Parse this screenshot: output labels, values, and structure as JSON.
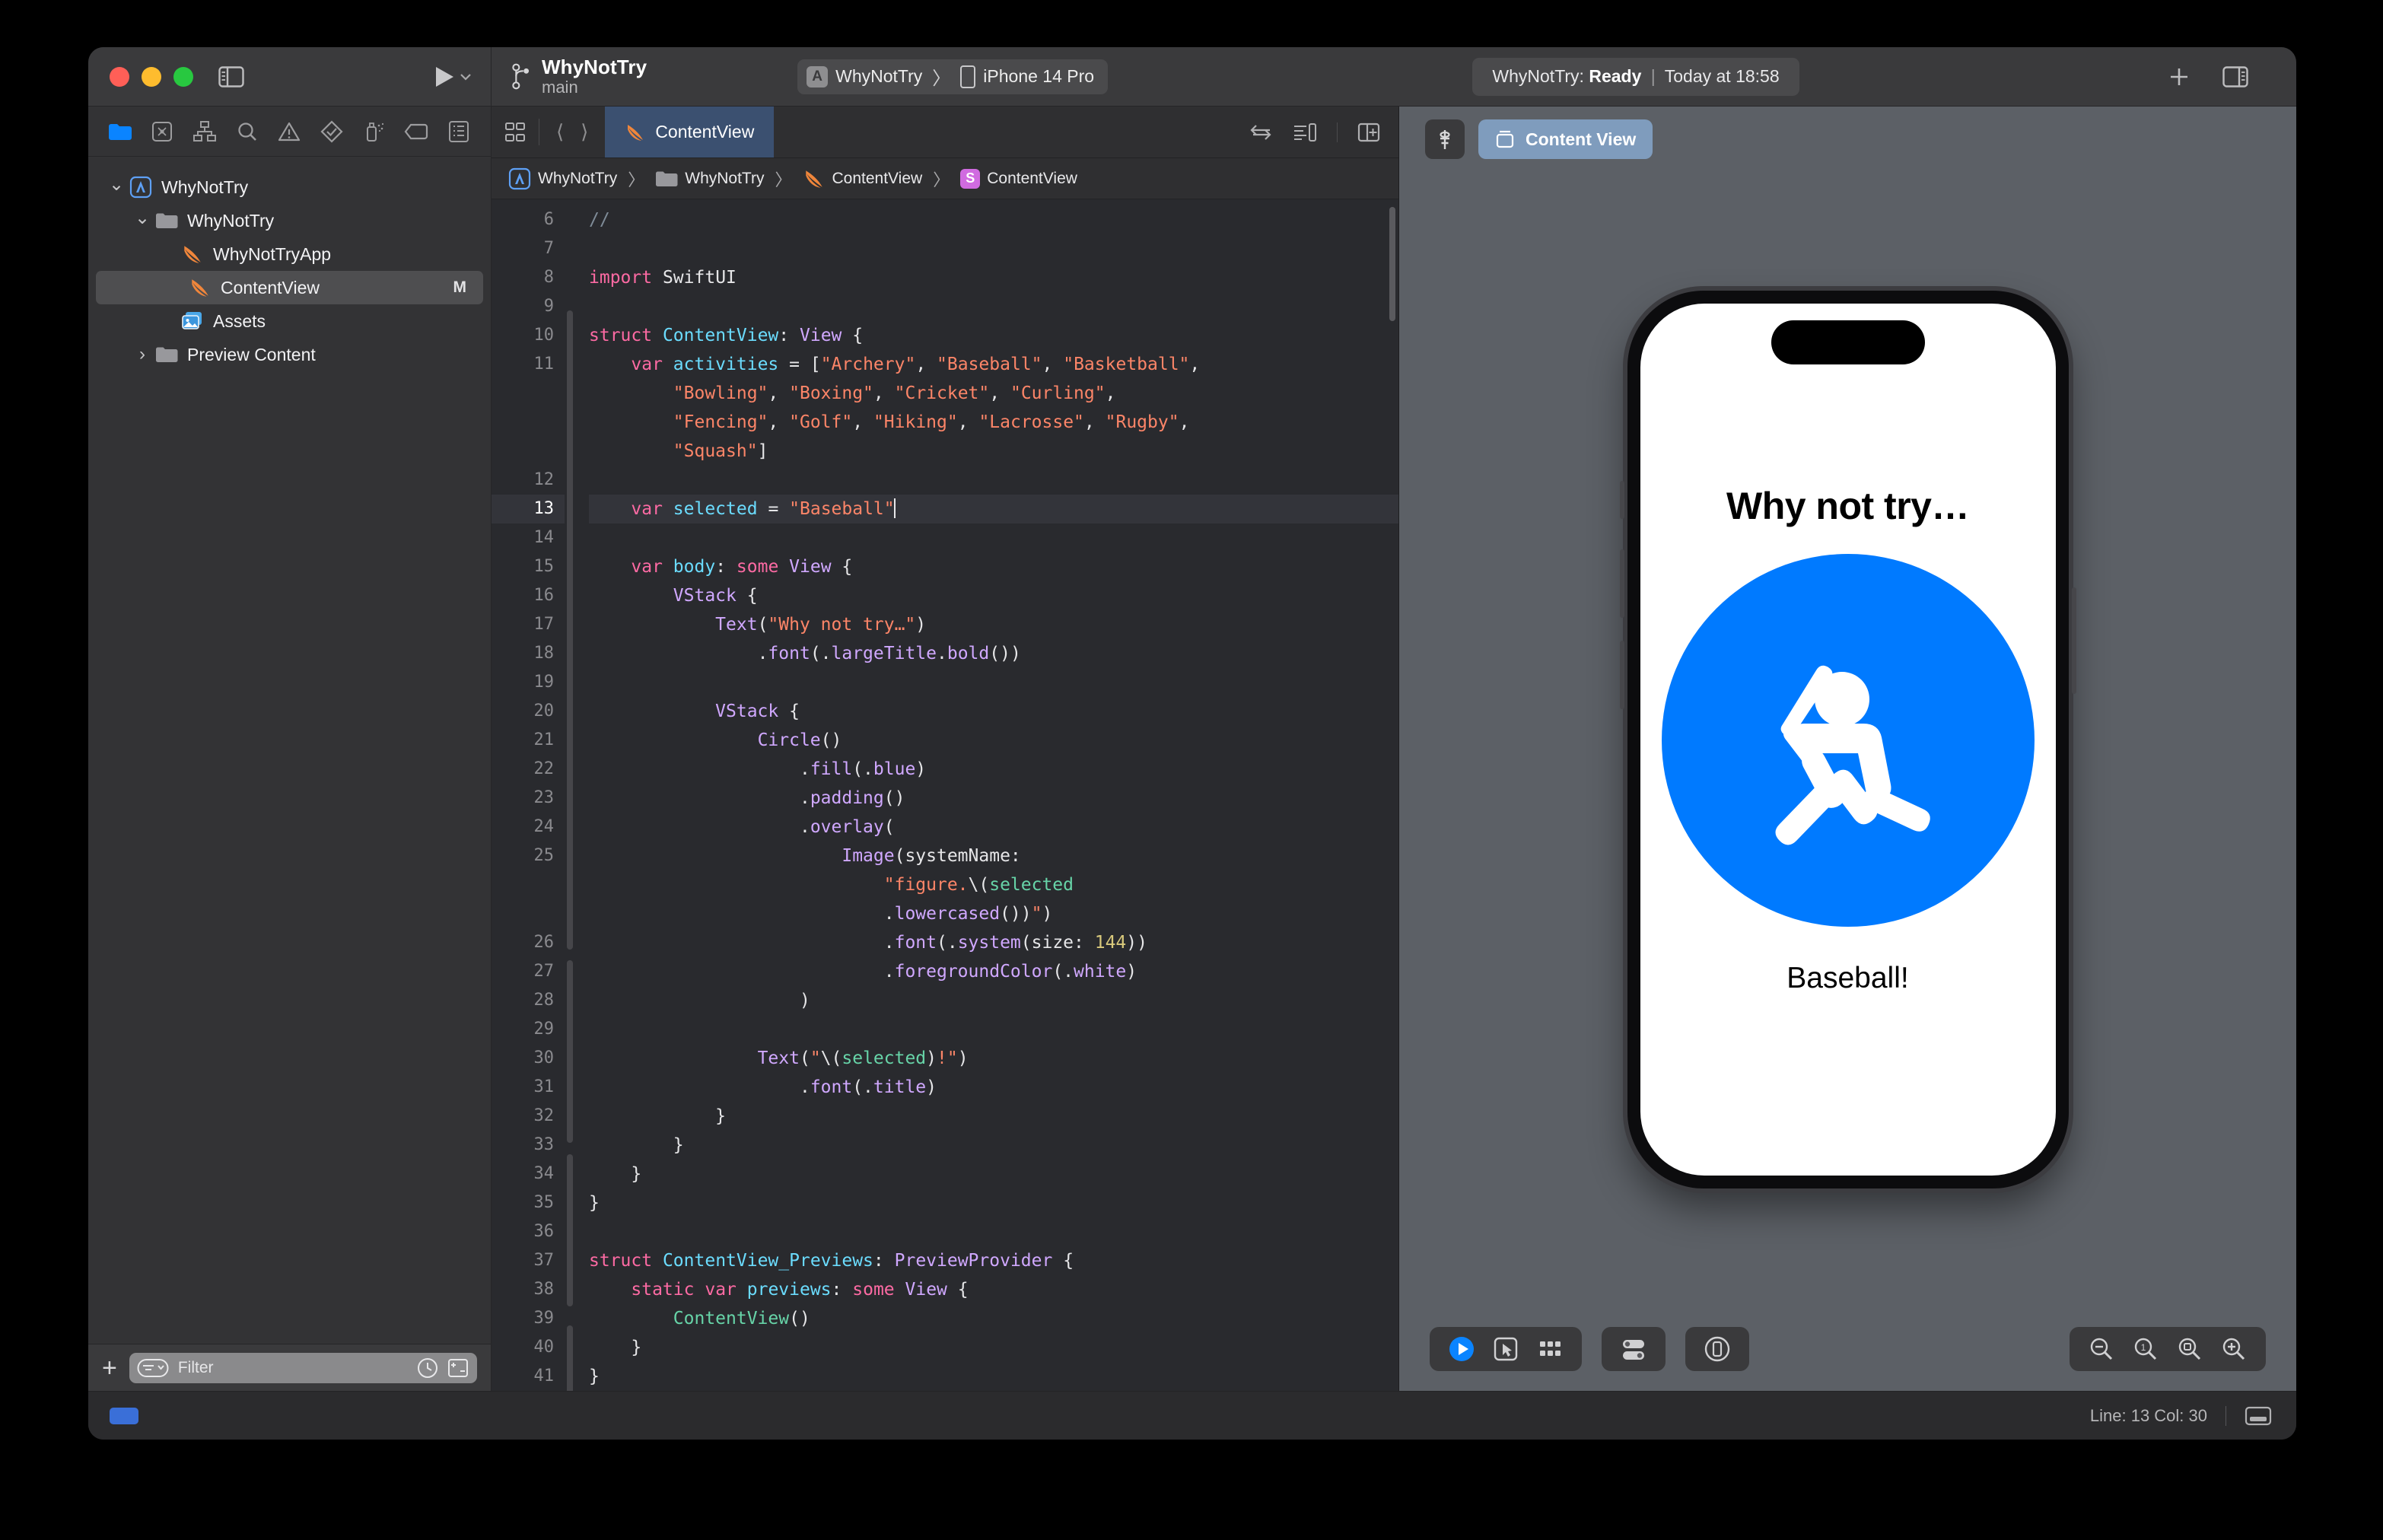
{
  "window": {
    "traffic_lights": [
      "close",
      "minimize",
      "zoom"
    ],
    "sidebar_toggle_icon": "sidebar-icon",
    "run_icon": "play-icon",
    "add_icon": "plus-icon",
    "inspector_toggle_icon": "inspector-icon"
  },
  "toolbar": {
    "project_title": "WhyNotTry",
    "branch": "main",
    "branch_icon": "branch-icon",
    "scheme": {
      "app_icon": "app-store-icon",
      "scheme_name": "WhyNotTry",
      "chevron": "〉",
      "device_icon": "iphone-icon",
      "destination": "iPhone 14 Pro"
    },
    "status": {
      "prefix": "WhyNotTry:",
      "state": "Ready",
      "separator": "|",
      "time": "Today at 18:58"
    }
  },
  "navigator": {
    "tabs": [
      {
        "name": "project-navigator",
        "icon": "folder-icon",
        "active": true
      },
      {
        "name": "source-control-navigator",
        "icon": "source-control-icon",
        "active": false
      },
      {
        "name": "symbol-navigator",
        "icon": "hierarchy-icon",
        "active": false
      },
      {
        "name": "find-navigator",
        "icon": "search-icon",
        "active": false
      },
      {
        "name": "issue-navigator",
        "icon": "warning-icon",
        "active": false
      },
      {
        "name": "test-navigator",
        "icon": "test-diamond-icon",
        "active": false
      },
      {
        "name": "debug-navigator",
        "icon": "spray-icon",
        "active": false
      },
      {
        "name": "breakpoint-navigator",
        "icon": "tag-icon",
        "active": false
      },
      {
        "name": "report-navigator",
        "icon": "report-icon",
        "active": false
      }
    ],
    "tree": [
      {
        "label": "WhyNotTry",
        "icon": "app-project-icon",
        "depth": 0,
        "twisty": "down",
        "selected": false,
        "badge": ""
      },
      {
        "label": "WhyNotTry",
        "icon": "folder-icon",
        "depth": 1,
        "twisty": "down",
        "selected": false,
        "badge": ""
      },
      {
        "label": "WhyNotTryApp",
        "icon": "swift-icon",
        "depth": 2,
        "twisty": "none",
        "selected": false,
        "badge": ""
      },
      {
        "label": "ContentView",
        "icon": "swift-icon",
        "depth": 2,
        "twisty": "none",
        "selected": true,
        "badge": "M"
      },
      {
        "label": "Assets",
        "icon": "assets-icon",
        "depth": 2,
        "twisty": "none",
        "selected": false,
        "badge": ""
      },
      {
        "label": "Preview Content",
        "icon": "folder-icon",
        "depth": 1,
        "twisty": "right",
        "selected": false,
        "badge": ""
      }
    ],
    "filter": {
      "add_icon": "plus-icon",
      "filter_menu_icon": "filter-menu-icon",
      "placeholder": "Filter",
      "recent_icon": "clock-icon",
      "source-control_icon": "added-removed-icon"
    }
  },
  "editor": {
    "tab_grid_icon": "tab-grid-icon",
    "back_icon": "chevron-left-icon",
    "forward_icon": "chevron-right-icon",
    "open_tab": {
      "label": "ContentView",
      "icon": "swift-icon"
    },
    "right_icons": [
      "related-items-icon",
      "minimap-icon",
      "add-editor-icon"
    ],
    "jumpbar": [
      {
        "label": "WhyNotTry",
        "icon": "app-project-icon"
      },
      {
        "label": "WhyNotTry",
        "icon": "folder-icon"
      },
      {
        "label": "ContentView",
        "icon": "swift-icon"
      },
      {
        "label": "ContentView",
        "icon": "struct-symbol-icon"
      }
    ],
    "cursor_line": 13,
    "lines": [
      {
        "n": "6",
        "html": "<span class='cmt'>//</span>"
      },
      {
        "n": "7",
        "html": ""
      },
      {
        "n": "8",
        "html": "<span class='kw'>import</span> <span class='plain'>SwiftUI</span>"
      },
      {
        "n": "9",
        "html": ""
      },
      {
        "n": "10",
        "html": "<span class='kw'>struct</span> <span class='typ'>ContentView</span><span class='plain'>:</span> <span class='typ2'>View</span> <span class='plain'>{</span>"
      },
      {
        "n": "11",
        "html": "    <span class='kw'>var</span> <span class='var'>activities</span> <span class='plain'>= [</span><span class='str'>\"Archery\"</span><span class='plain'>,</span> <span class='str'>\"Baseball\"</span><span class='plain'>,</span> <span class='str'>\"Basketball\"</span><span class='plain'>,</span>"
      },
      {
        "n": "",
        "html": "        <span class='str'>\"Bowling\"</span><span class='plain'>,</span> <span class='str'>\"Boxing\"</span><span class='plain'>,</span> <span class='str'>\"Cricket\"</span><span class='plain'>,</span> <span class='str'>\"Curling\"</span><span class='plain'>,</span>"
      },
      {
        "n": "",
        "html": "        <span class='str'>\"Fencing\"</span><span class='plain'>,</span> <span class='str'>\"Golf\"</span><span class='plain'>,</span> <span class='str'>\"Hiking\"</span><span class='plain'>,</span> <span class='str'>\"Lacrosse\"</span><span class='plain'>,</span> <span class='str'>\"Rugby\"</span><span class='plain'>,</span>"
      },
      {
        "n": "",
        "html": "        <span class='str'>\"Squash\"</span><span class='plain'>]</span>"
      },
      {
        "n": "12",
        "html": ""
      },
      {
        "n": "13",
        "html": "    <span class='kw'>var</span> <span class='var'>selected</span> <span class='plain'>=</span> <span class='str'>\"Baseball\"</span><span class='caret'></span>",
        "highlight": true
      },
      {
        "n": "14",
        "html": ""
      },
      {
        "n": "15",
        "html": "    <span class='kw'>var</span> <span class='var'>body</span><span class='plain'>:</span> <span class='kw'>some</span> <span class='typ2'>View</span> <span class='plain'>{</span>"
      },
      {
        "n": "16",
        "html": "        <span class='fn'>VStack</span> <span class='plain'>{</span>"
      },
      {
        "n": "17",
        "html": "            <span class='fn'>Text</span><span class='plain'>(</span><span class='str'>\"Why not try…\"</span><span class='plain'>)</span>"
      },
      {
        "n": "18",
        "html": "                <span class='plain'>.</span><span class='fn'>font</span><span class='plain'>(.</span><span class='fn'>largeTitle</span><span class='plain'>.</span><span class='fn'>bold</span><span class='plain'>())</span>"
      },
      {
        "n": "19",
        "html": ""
      },
      {
        "n": "20",
        "html": "            <span class='fn'>VStack</span> <span class='plain'>{</span>"
      },
      {
        "n": "21",
        "html": "                <span class='fn'>Circle</span><span class='plain'>()</span>"
      },
      {
        "n": "22",
        "html": "                    <span class='plain'>.</span><span class='fn'>fill</span><span class='plain'>(.</span><span class='fn'>blue</span><span class='plain'>)</span>"
      },
      {
        "n": "23",
        "html": "                    <span class='plain'>.</span><span class='fn'>padding</span><span class='plain'>()</span>"
      },
      {
        "n": "24",
        "html": "                    <span class='plain'>.</span><span class='fn'>overlay</span><span class='plain'>(</span>"
      },
      {
        "n": "25",
        "html": "                        <span class='fn'>Image</span><span class='plain'>(systemName:</span>"
      },
      {
        "n": "",
        "html": "                            <span class='str'>\"figure.</span><span class='plain'>\\(</span><span class='grn'>selected</span>"
      },
      {
        "n": "",
        "html": "                            <span class='plain'>.</span><span class='fn'>lowercased</span><span class='plain'>())</span><span class='str'>\"</span><span class='plain'>)</span>"
      },
      {
        "n": "26",
        "html": "                            <span class='plain'>.</span><span class='fn'>font</span><span class='plain'>(.</span><span class='fn'>system</span><span class='plain'>(size:</span> <span class='num'>144</span><span class='plain'>))</span>"
      },
      {
        "n": "27",
        "html": "                            <span class='plain'>.</span><span class='fn'>foregroundColor</span><span class='plain'>(.</span><span class='fn'>white</span><span class='plain'>)</span>"
      },
      {
        "n": "28",
        "html": "                    <span class='plain'>)</span>"
      },
      {
        "n": "29",
        "html": ""
      },
      {
        "n": "30",
        "html": "                <span class='fn'>Text</span><span class='plain'>(</span><span class='str'>\"</span><span class='plain'>\\(</span><span class='grn'>selected</span><span class='plain'>)</span><span class='str'>!\"</span><span class='plain'>)</span>"
      },
      {
        "n": "31",
        "html": "                    <span class='plain'>.</span><span class='fn'>font</span><span class='plain'>(.</span><span class='fn'>title</span><span class='plain'>)</span>"
      },
      {
        "n": "32",
        "html": "            <span class='plain'>}</span>"
      },
      {
        "n": "33",
        "html": "        <span class='plain'>}</span>"
      },
      {
        "n": "34",
        "html": "    <span class='plain'>}</span>"
      },
      {
        "n": "35",
        "html": "<span class='plain'>}</span>"
      },
      {
        "n": "36",
        "html": ""
      },
      {
        "n": "37",
        "html": "<span class='kw'>struct</span> <span class='typ'>ContentView_Previews</span><span class='plain'>:</span> <span class='typ2'>PreviewProvider</span> <span class='plain'>{</span>"
      },
      {
        "n": "38",
        "html": "    <span class='kw'>static</span> <span class='kw'>var</span> <span class='var'>previews</span><span class='plain'>:</span> <span class='kw'>some</span> <span class='typ2'>View</span> <span class='plain'>{</span>"
      },
      {
        "n": "39",
        "html": "        <span class='grn'>ContentView</span><span class='plain'>()</span>"
      },
      {
        "n": "40",
        "html": "    <span class='plain'>}</span>"
      },
      {
        "n": "41",
        "html": "<span class='plain'>}</span>"
      },
      {
        "n": "42",
        "html": ""
      }
    ]
  },
  "canvas": {
    "pin_icon": "pin-icon",
    "preview_chip": {
      "icon": "preview-cube-icon",
      "label": "Content View"
    },
    "device_name": "iPhone 14 Pro",
    "preview": {
      "title": "Why not try…",
      "circle_color": "#007aff",
      "figure_icon": "figure-baseball-icon",
      "label": "Baseball!"
    },
    "bottom_controls": {
      "live_icon": "live-play-icon",
      "selectable_icon": "selectable-pointer-icon",
      "variants_icon": "variants-grid-icon",
      "device_settings_icon": "device-settings-icon",
      "orientation_icon": "device-orientation-icon",
      "zoom_out_icon": "zoom-out-icon",
      "zoom_actual_icon": "zoom-100-icon",
      "zoom_fit_icon": "zoom-fit-icon",
      "zoom_in_icon": "zoom-in-icon"
    }
  },
  "statusbar": {
    "build_chip": "build-progress-chip",
    "line_col": "Line: 13  Col: 30",
    "editor_options_icon": "editor-options-icon"
  }
}
